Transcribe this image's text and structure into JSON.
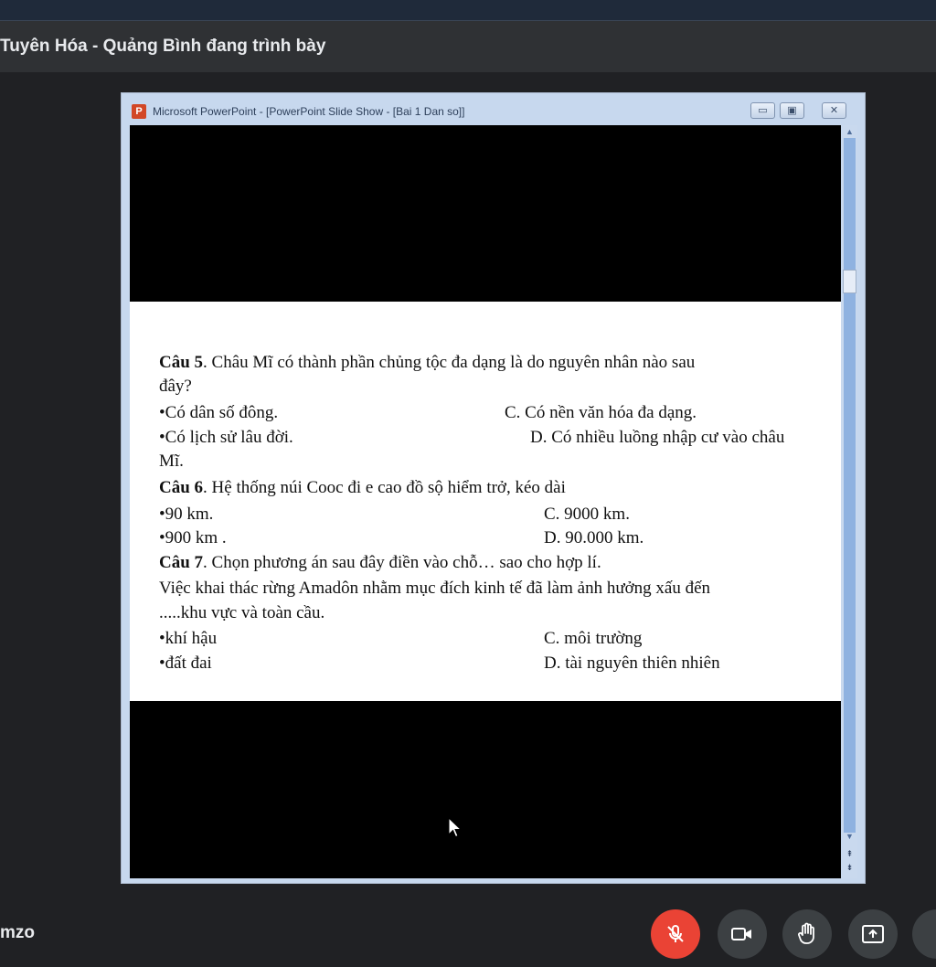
{
  "meeting": {
    "presenter_banner": "Tuyên Hóa - Quảng Bình đang trình bày",
    "meeting_code": "mzo"
  },
  "ppt_window": {
    "title": "Microsoft PowerPoint - [PowerPoint Slide Show - [Bai 1 Dan so]]",
    "logo_letter": "P"
  },
  "slide": {
    "lines": [
      {
        "bold": "Câu 5",
        "text": ". Châu Mĩ có thành phần chủng tộc đa dạng là do nguyên nhân nào sau"
      },
      {
        "bold": "",
        "text": "đây?"
      },
      {
        "bold": "",
        "text": "•Có dân số đông."
      },
      {
        "bold": "",
        "text": "C. Có nền văn hóa đa dạng."
      },
      {
        "bold": "",
        "text": "•Có lịch sử lâu đời."
      },
      {
        "bold": "",
        "text": "D. Có nhiều luồng nhập cư vào châu"
      },
      {
        "bold": "",
        "text": "Mĩ."
      },
      {
        "bold": "Câu 6",
        "text": ". Hệ thống núi Cooc đi e cao đồ sộ hiểm trở, kéo dài"
      },
      {
        "bold": "",
        "text": "•90 km."
      },
      {
        "bold": "",
        "text": "C. 9000 km."
      },
      {
        "bold": "",
        "text": "•900 km ."
      },
      {
        "bold": "",
        "text": "D. 90.000 km."
      },
      {
        "bold": "Câu 7",
        "text": ". Chọn phương án sau đây điền vào chỗ… sao cho hợp lí."
      },
      {
        "bold": "",
        "text": "Việc khai thác rừng Amadôn nhằm mục đích kinh tế đã làm ảnh hưởng xấu đến"
      },
      {
        "bold": "",
        "text": ".....khu vực và toàn cầu."
      },
      {
        "bold": "",
        "text": "•khí hậu"
      },
      {
        "bold": "",
        "text": "C. môi trường"
      },
      {
        "bold": "",
        "text": "•đất đai"
      },
      {
        "bold": "",
        "text": "D. tài nguyên thiên nhiên"
      }
    ]
  },
  "controls": [
    {
      "name": "mic-off-button",
      "icon": "mic-off-icon",
      "color": "#ea4335"
    },
    {
      "name": "camera-button",
      "icon": "camera-icon",
      "color": "#3c4043"
    },
    {
      "name": "raise-hand-button",
      "icon": "hand-icon",
      "color": "#3c4043"
    },
    {
      "name": "present-button",
      "icon": "present-screen-icon",
      "color": "#3c4043"
    }
  ]
}
